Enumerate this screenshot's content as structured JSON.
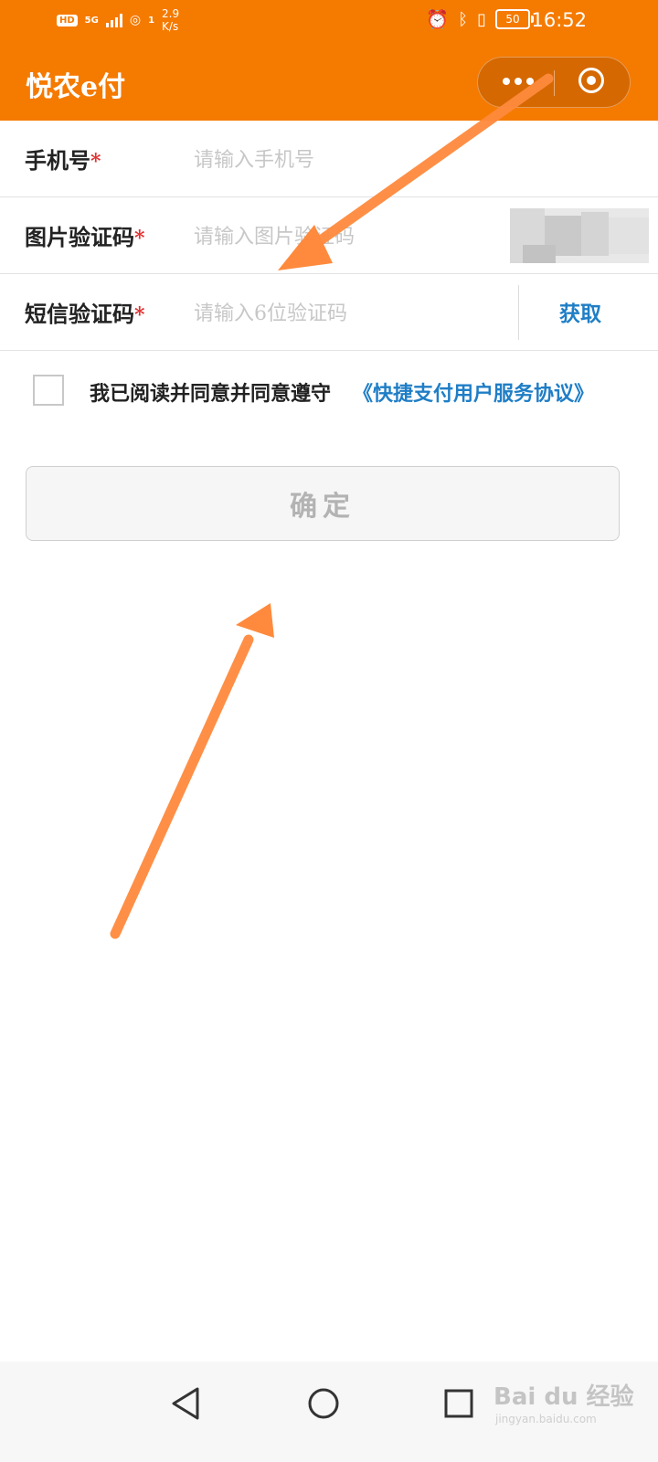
{
  "status_bar": {
    "hd": "HD",
    "network": "5G",
    "hotspot_count": "1",
    "speed_value": "2.9",
    "speed_unit": "K/s",
    "battery": "50",
    "time": "16:52"
  },
  "header": {
    "title": "悦农e付",
    "brand_color": "#f57a00"
  },
  "form": {
    "phone": {
      "label": "手机号",
      "required_mark": "*",
      "placeholder": "请输入手机号",
      "value": ""
    },
    "image_captcha": {
      "label": "图片验证码",
      "required_mark": "*",
      "placeholder": "请输入图片验证码",
      "value": ""
    },
    "sms_code": {
      "label": "短信验证码",
      "required_mark": "*",
      "placeholder": "请输入6位验证码",
      "value": "",
      "get_button": "获取"
    }
  },
  "agreement": {
    "checked": false,
    "text": "我已阅读并同意并同意遵守",
    "link_text": "《快捷支付用户服务协议》",
    "link_color": "#1f7ec6"
  },
  "confirm_button": {
    "label": "确定"
  },
  "annotation": {
    "arrow_color": "#ff8a3d"
  },
  "navbar": {
    "icons": [
      "back-triangle-icon",
      "home-circle-icon",
      "recent-square-icon"
    ]
  },
  "watermark": {
    "text": "Bai du 经验",
    "sub": "jingyan.baidu.com"
  }
}
